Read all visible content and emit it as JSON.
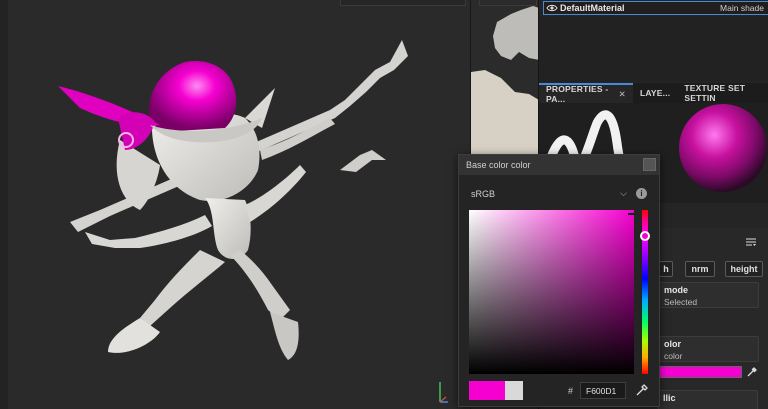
{
  "material_list": {
    "item_name": "DefaultMaterial",
    "shader": "Main shade"
  },
  "tabs": [
    {
      "label": "PROPERTIES - PA...",
      "active": true
    },
    {
      "label": "LAYE...",
      "active": false
    },
    {
      "label": "TEXTURE SET SETTIN",
      "active": false
    }
  ],
  "properties": {
    "channel_chips": [
      "h",
      "nrm",
      "height"
    ],
    "mode_title": "mode",
    "mode_value": "Selected",
    "color_title": "olor",
    "color_sub": "color",
    "metallic_title": "llic"
  },
  "color_picker": {
    "title": "Base color color",
    "color_space": "sRGB",
    "hex_label": "#",
    "hex_value": "F600D1"
  },
  "colors": {
    "accent": "#4a89d6",
    "base_color": "#f600d1",
    "previous_color": "#d9d9d9"
  },
  "icons": [
    "eye-icon",
    "close-icon",
    "chevron-down-icon",
    "info-icon",
    "eyedropper-icon",
    "menu-lines-icon",
    "axis-gizmo-icon"
  ]
}
